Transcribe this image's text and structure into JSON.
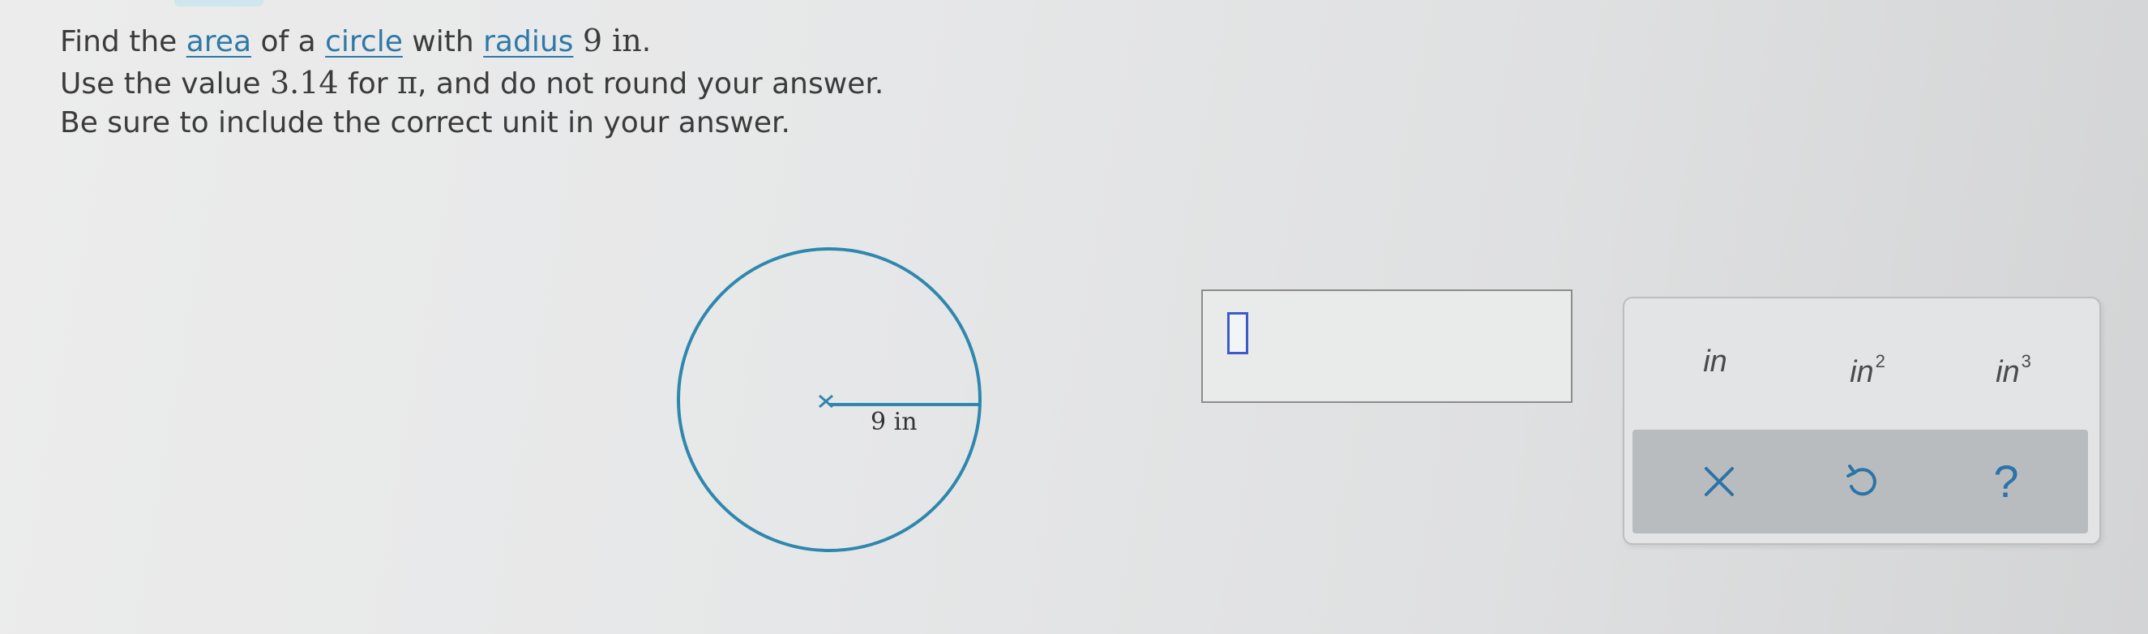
{
  "question": {
    "line1": {
      "p1": "Find the ",
      "area_term": "area",
      "p2": " of a ",
      "circle_term": "circle",
      "p3": " with ",
      "radius_term": "radius",
      "p4": " ",
      "radius_value": "9 in",
      "p5": "."
    },
    "line2": {
      "p1": "Use the value ",
      "pi_value": "3.14",
      "p2": " for ",
      "pi_symbol": "π",
      "p3": ", and do not round your answer."
    },
    "line3": "Be sure to include the correct unit in your answer."
  },
  "figure": {
    "radius_label": "9 in",
    "stroke_color": "#2e87ad"
  },
  "answer": {
    "value": ""
  },
  "keypad": {
    "units": [
      {
        "base": "in",
        "exp": ""
      },
      {
        "base": "in",
        "exp": "2"
      },
      {
        "base": "in",
        "exp": "3"
      }
    ],
    "actions": [
      {
        "icon": "close-icon"
      },
      {
        "icon": "undo-icon"
      },
      {
        "icon": "help-icon",
        "glyph": "?"
      }
    ],
    "accent_color": "#2b73a8"
  }
}
